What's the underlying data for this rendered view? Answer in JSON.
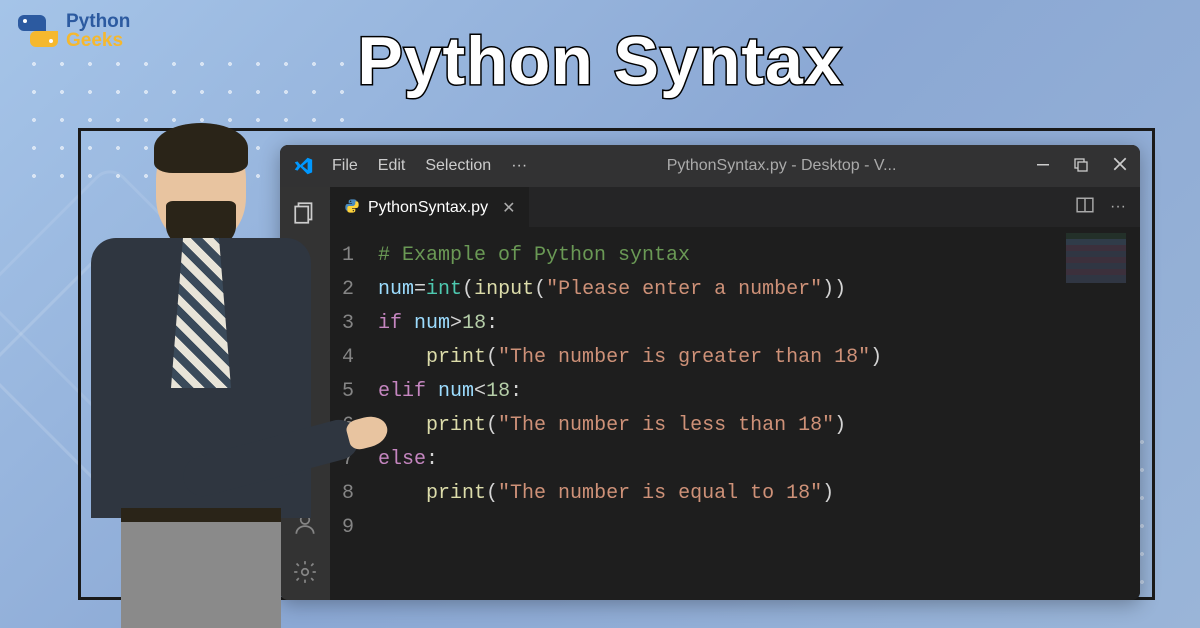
{
  "logo": {
    "top": "Python",
    "bottom": "Geeks"
  },
  "title": "Python Syntax",
  "titlebar": {
    "menu": {
      "file": "File",
      "edit": "Edit",
      "selection": "Selection",
      "more": "···"
    },
    "title": "PythonSyntax.py - Desktop - V..."
  },
  "tab": {
    "filename": "PythonSyntax.py"
  },
  "code": {
    "lines": [
      "1",
      "2",
      "3",
      "4",
      "5",
      "6",
      "7",
      "8",
      "9"
    ],
    "l1": {
      "comment": "# Example of Python syntax"
    },
    "l2": {
      "var": "num",
      "eq": "=",
      "fn_int": "int",
      "op1": "(",
      "fn_input": "input",
      "op2": "(",
      "str": "\"Please enter a number\"",
      "op3": "))"
    },
    "l3": {
      "kw": "if",
      "sp": " ",
      "var": "num",
      "op": ">",
      "num": "18",
      "colon": ":"
    },
    "l4": {
      "indent": "    ",
      "fn": "print",
      "op1": "(",
      "str": "\"The number is greater than 18\"",
      "op2": ")"
    },
    "l5": {
      "kw": "elif",
      "sp": " ",
      "var": "num",
      "op": "<",
      "num": "18",
      "colon": ":"
    },
    "l6": {
      "indent": "    ",
      "fn": "print",
      "op1": "(",
      "str": "\"The number is less than 18\"",
      "op2": ")"
    },
    "l7": {
      "kw": "else",
      "colon": ":"
    },
    "l8": {
      "indent": "    ",
      "fn": "print",
      "op1": "(",
      "str": "\"The number is equal to 18\"",
      "op2": ")"
    }
  }
}
